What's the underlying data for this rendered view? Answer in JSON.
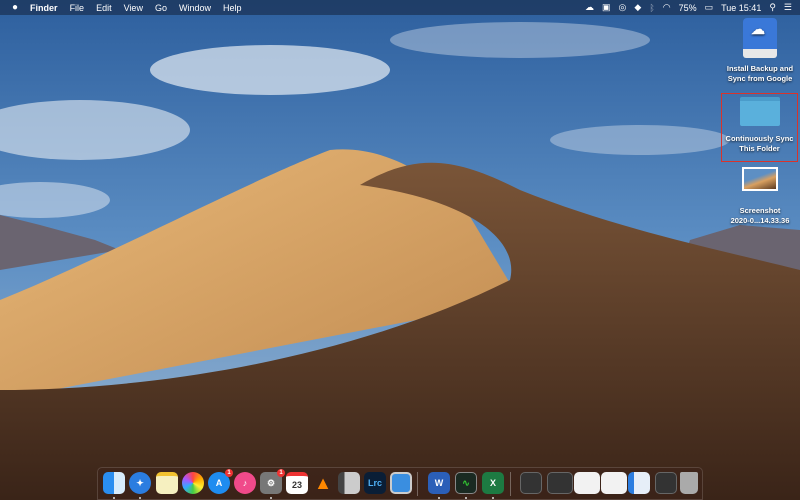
{
  "menubar": {
    "apple": "",
    "app": "Finder",
    "items": [
      "File",
      "Edit",
      "View",
      "Go",
      "Window",
      "Help"
    ],
    "battery": "75%",
    "clock": "Tue 15:41"
  },
  "desktop": [
    {
      "label1": "Install Backup and",
      "label2": "Sync from Google"
    },
    {
      "label1": "Continuously Sync",
      "label2": "This Folder",
      "highlight_color": "#d9332b"
    },
    {
      "label1": "Screenshot",
      "label2": "2020-0...14.33.36"
    }
  ],
  "dock": {
    "apps": [
      {
        "name": "Finder",
        "running": true
      },
      {
        "name": "Safari",
        "running": true
      },
      {
        "name": "Notes"
      },
      {
        "name": "Photos"
      },
      {
        "name": "App Store",
        "badge": "1"
      },
      {
        "name": "iTunes"
      },
      {
        "name": "System Preferences",
        "badge": "1",
        "running": true
      },
      {
        "name": "Calendar",
        "day": "23"
      },
      {
        "name": "VLC"
      },
      {
        "name": "Preview"
      },
      {
        "name": "Lightroom Classic",
        "text": "Lrc"
      },
      {
        "name": "Screen Sharing"
      },
      {
        "name": "Microsoft Word",
        "text": "W",
        "running": true
      },
      {
        "name": "Activity Monitor",
        "running": true
      },
      {
        "name": "Microsoft Excel",
        "text": "X",
        "running": true
      }
    ]
  }
}
